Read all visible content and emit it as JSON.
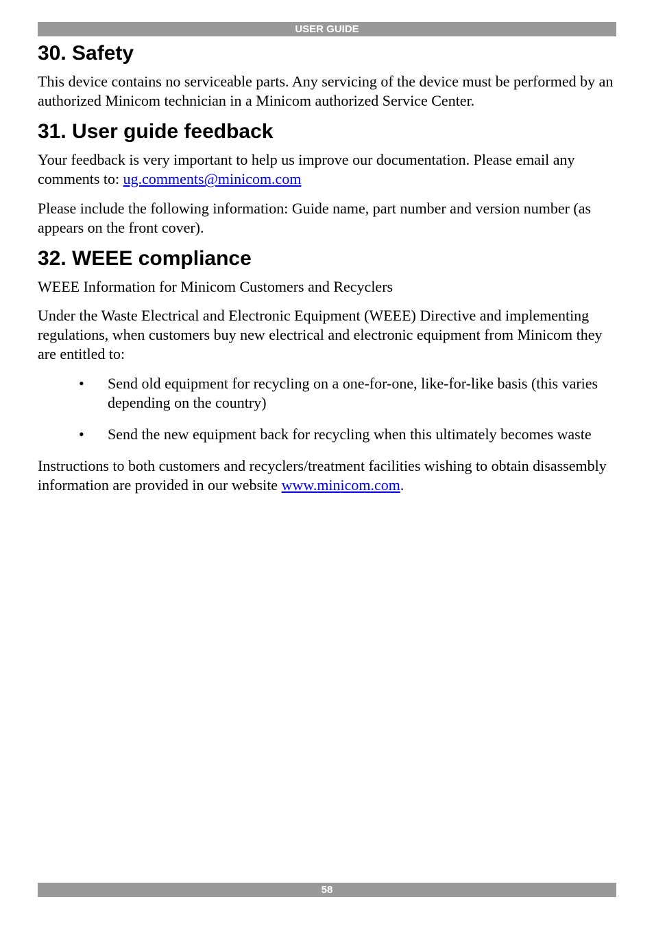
{
  "header": {
    "title": "USER GUIDE"
  },
  "sections": {
    "safety": {
      "heading": "30. Safety",
      "p1": "This device contains no serviceable parts. Any servicing of the device must be performed by an authorized Minicom technician in a Minicom authorized Service Center."
    },
    "feedback": {
      "heading": "31. User guide feedback",
      "p1_pre": "Your feedback is very important to help us improve our documentation. Please email any comments to: ",
      "email": "ug.comments@minicom.com",
      "p2": "Please include the following information: Guide name, part number and version number (as appears on the front cover)."
    },
    "weee": {
      "heading": "32. WEEE compliance",
      "p1": "WEEE Information for Minicom Customers and Recyclers",
      "p2": "Under the Waste Electrical and Electronic Equipment (WEEE) Directive and implementing regulations, when customers buy new electrical and electronic equipment from Minicom they are entitled to:",
      "bullets": [
        "Send old equipment for recycling on a one-for-one, like-for-like basis (this varies depending on the country)",
        "Send the new equipment back for recycling when this ultimately becomes waste"
      ],
      "p3_pre": "Instructions to both customers and recyclers/treatment facilities wishing to obtain disassembly information are provided in our website ",
      "url": "www.minicom.com",
      "p3_post": "."
    }
  },
  "footer": {
    "page": "58"
  }
}
